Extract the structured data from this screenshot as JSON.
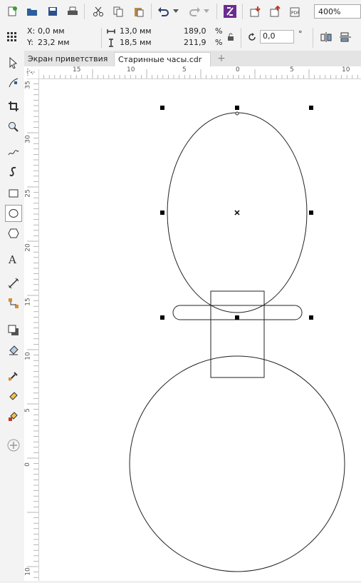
{
  "toolbar": {
    "zoom_value": "400%",
    "icons": [
      "new-icon",
      "open-icon",
      "save-icon",
      "print-icon",
      "cut-icon",
      "copy-icon",
      "paste-icon",
      "undo-icon",
      "redo-icon",
      "launcher-icon",
      "import-icon",
      "export-icon",
      "pdf-icon"
    ]
  },
  "property_bar": {
    "x_label": "X:",
    "x_value": "0,0 мм",
    "y_label": "Y:",
    "y_value": "23,2 мм",
    "width_value": "13,0 мм",
    "height_value": "18,5 мм",
    "scale_x": "189,0",
    "scale_y": "211,9",
    "percent": "%",
    "rotation_value": "0,0",
    "degree": "°"
  },
  "tabs": [
    {
      "label": "Экран приветствия",
      "active": false
    },
    {
      "label": "Старинные часы.cdr",
      "active": true
    }
  ],
  "add_tab_label": "+",
  "ruler_top": {
    "labels": [
      "15",
      "10",
      "5",
      "0",
      "5",
      "10"
    ]
  },
  "ruler_left": {
    "labels": [
      "35",
      "30",
      "25",
      "20",
      "15",
      "10",
      "5",
      "0",
      "10"
    ]
  },
  "toolbox": [
    "pick-tool-icon",
    "shape-tool-icon",
    "crop-tool-icon",
    "zoom-tool-icon",
    "freehand-tool-icon",
    "artistic-media-icon",
    "rectangle-tool-icon",
    "ellipse-tool-icon",
    "polygon-tool-icon",
    "text-tool-icon",
    "dimension-tool-icon",
    "connector-tool-icon",
    "drop-shadow-icon",
    "transparency-icon",
    "eyedropper-icon",
    "interactive-fill-icon",
    "smart-fill-icon",
    "add-tool-icon"
  ],
  "accent": "#6a2c91"
}
